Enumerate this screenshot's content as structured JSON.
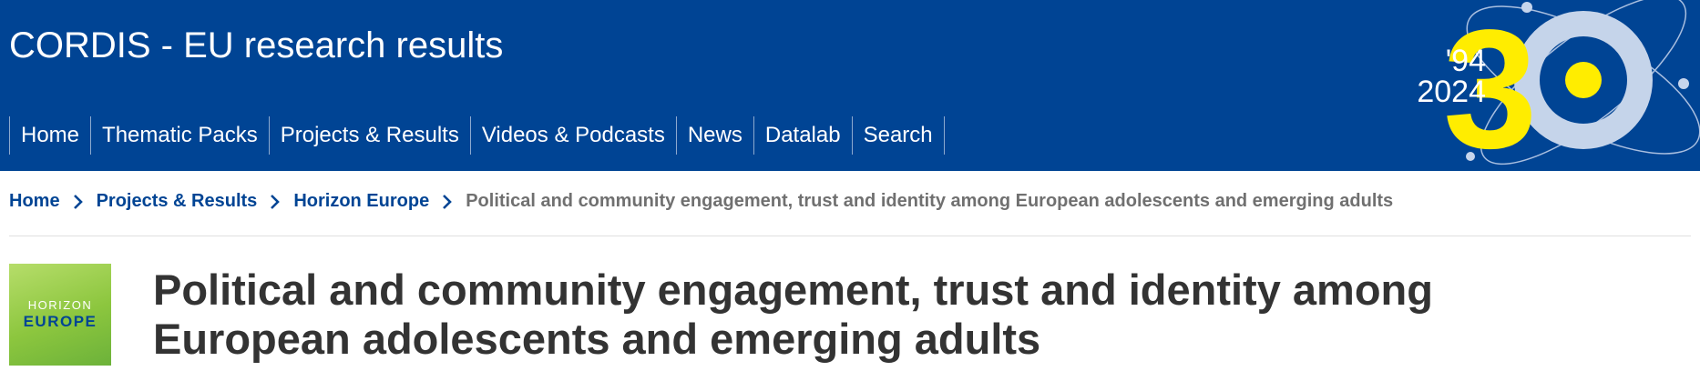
{
  "header": {
    "site_title": "CORDIS - EU research results",
    "nav": [
      "Home",
      "Thematic Packs",
      "Projects & Results",
      "Videos & Podcasts",
      "News",
      "Datalab",
      "Search"
    ],
    "anniversary": {
      "years_apostrophe": "'94",
      "year_end": "2024",
      "number_3": "3",
      "number_0": "0"
    },
    "colors": {
      "background": "#004494",
      "accent_yellow": "#ffed00"
    }
  },
  "breadcrumb": {
    "items": [
      "Home",
      "Projects & Results",
      "Horizon Europe"
    ],
    "current": "Political and community engagement, trust and identity among European adolescents and emerging adults"
  },
  "programme_logo": {
    "line1": "HORIZON",
    "line2": "EUROPE"
  },
  "page": {
    "title_line1": "Political and community engagement, trust and identity among",
    "title_line2": "European adolescents and emerging adults"
  },
  "icons": {
    "breadcrumb_separator": "chevron-right-icon"
  }
}
